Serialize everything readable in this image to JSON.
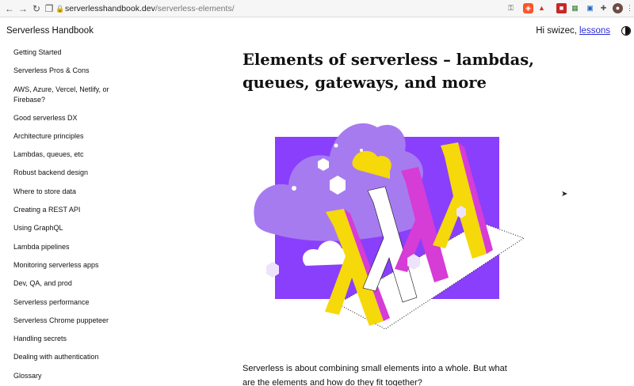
{
  "browser": {
    "url_domain": "serverlesshandbook.dev",
    "url_path": "/serverless-elements/"
  },
  "header": {
    "site_title": "Serverless Handbook",
    "greeting": "Hi swizec,",
    "lessons_link": "lessons"
  },
  "sidebar": {
    "items": [
      {
        "label": "Getting Started"
      },
      {
        "label": "Serverless Pros & Cons"
      },
      {
        "label": "AWS, Azure, Vercel, Netlify, or Firebase?"
      },
      {
        "label": "Good serverless DX"
      },
      {
        "label": "Architecture principles"
      },
      {
        "label": "Lambdas, queues, etc"
      },
      {
        "label": "Robust backend design"
      },
      {
        "label": "Where to store data"
      },
      {
        "label": "Creating a REST API"
      },
      {
        "label": "Using GraphQL"
      },
      {
        "label": "Lambda pipelines"
      },
      {
        "label": "Monitoring serverless apps"
      },
      {
        "label": "Dev, QA, and prod"
      },
      {
        "label": "Serverless performance"
      },
      {
        "label": "Serverless Chrome puppeteer"
      },
      {
        "label": "Handling secrets"
      },
      {
        "label": "Dealing with authentication"
      },
      {
        "label": "Glossary"
      }
    ]
  },
  "main": {
    "title": "Elements of serverless – lambdas, queues, gateways, and more",
    "intro": "Serverless is about combining small elements into a whole. But what are the elements and how do they fit together?"
  },
  "colors": {
    "purple": "#8a3ffc",
    "lavender": "#a77bf0",
    "magenta": "#d63cd6",
    "yellow": "#f5d90a",
    "link": "#2c2cd8"
  }
}
